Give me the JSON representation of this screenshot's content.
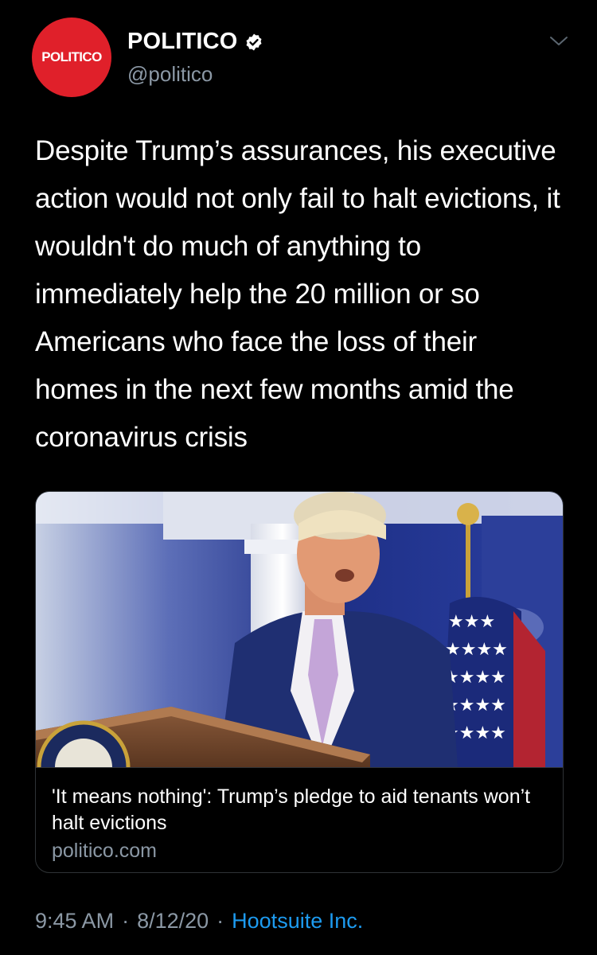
{
  "account": {
    "avatar_text": "POLITICO",
    "display_name": "POLITICO",
    "handle": "@politico",
    "verified": true,
    "avatar_color": "#e0202a"
  },
  "tweet": {
    "text": "Despite Trump’s assurances, his executive action would not only fail to halt evictions, it wouldn't do much of anything to immediately help the 20 million or so Americans who face the loss of their homes in the next few months amid the coronavirus crisis"
  },
  "card": {
    "title": "'It means nothing': Trump’s pledge to aid tenants won’t halt evictions",
    "domain": "politico.com"
  },
  "meta": {
    "time": "9:45 AM",
    "date": "8/12/20",
    "separator": "·",
    "source": "Hootsuite Inc.",
    "source_color": "#1d9bf0"
  },
  "icons": {
    "verified": "verified-badge-icon",
    "menu": "chevron-down-icon"
  }
}
